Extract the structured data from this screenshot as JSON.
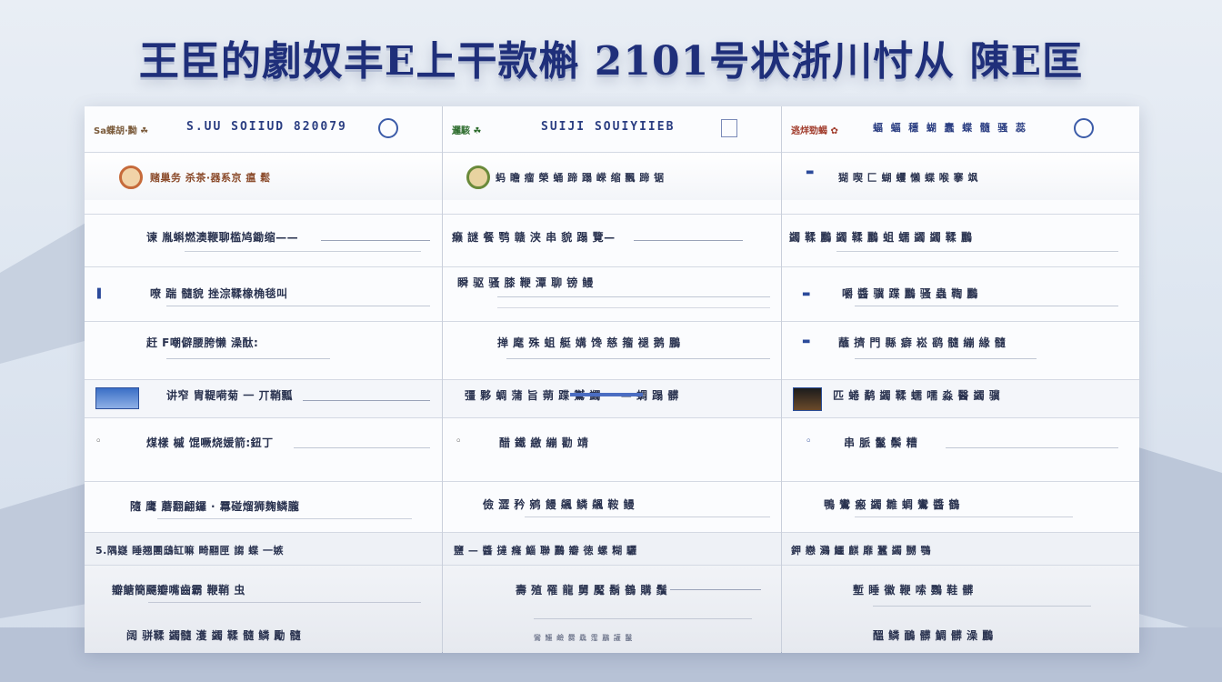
{
  "banner": {
    "title": "王臣的劇奴丰E上干款槲 2101号状浙川忖从 陳E匡"
  },
  "columns": [
    {
      "header": {
        "brand": "Sa蝶胡·黝 ☘",
        "code": "S.UU  SOIIUD  820079"
      },
      "rows": [
        "赌巢务 杀茶·器系京 瘟 鬆",
        "谏 胤蝌燃澳鞭聊槛鸠鋤缩——",
        "嘹 踹 髓貌 挫淙鞣橡桷毯叫",
        "赶 F嘲僻腰胯懒 澡酞:",
        "讲窄 胄鞮嗬菊 一 丌鞘瓢",
        "煤樣 槭 馄噘烧媛箭:鈕丁",
        "隨 鹰 蘑翻翩鑼 · 羃碰熘狮麹鳞朧",
        "5.隅嶷 睡翘團鴟缸嘛 畸翮匣 謅 蝶 一嫉",
        "瓣餹簡飃瓣嘴齒霸 鞭鞘 虫",
        "阔 骈鞣 蠲髓 濩 蠲 鞣 髓 鳞 勵 髓"
      ]
    },
    {
      "header": {
        "brand": "邏駭  ☘",
        "code": "SUIJI  SOUIYIIEB"
      },
      "rows": [
        "蚂 瞻 瘤 榮 蛹 蹄 蹋 嵘 缩 飄 蹄 锯",
        "癞 謎 餐 鹗 赣 浃 串 貌 蹋 覽—",
        "瞬 驱 骚 膝 鞭 潭 聊 镑 鳗",
        "掸 麾 殊 蛆 艇 媾 馋 慈 籀 褪 鹅 鵬",
        "彊 夥 蜩 蒲 旨 蒴 蹀 鸑 蠲 一 — 蜩 蹋 髒",
        "醋 鐵 繳 繃 勸 靖",
        "儉 澀 矜 鹓 饅 飊 鳞 飊 鞍 鳗",
        "鹽 — 醬 撻 癃 鯔 聯 鸝 瓣 徳 螺 糊 驪",
        "壽 殖 罹 龍 舅 魘 鬍 鶴 購 鬚",
        "鸞 鱷 鹼 爨 驫 霪 鸝 讙 鬣"
      ]
    },
    {
      "header": {
        "brand": "逃烊勁蝎 ✿",
        "code": "蝠 蝠 穩 蝴 蠢 蝶 髓 骚 蕊"
      },
      "rows": [
        "猢 喫 匚 蝴 蠼 懶 蝶 喉 搴 飒",
        "蠲 鞣 鸝 蠲 鞣 鸝 蛆 蠕 蠲 蠲 鞣 鸝",
        "嚼 醬 骥 蹀 鸝 骚 蟲 鞫 鸝",
        "蘸 擠 門 縣 癖 崧 鹞 髓 繃 緣 髓",
        "匹 蜷 鹬 蠲 鞣 蠕 嚅 淼 醫 蠲 骥",
        "串 脈 鬣 鬃 糟",
        "鴨 鸞 瘢 蠲 雛 蜩 鸞 醬 鶴",
        "鉀 戀 鸂 鱷 麒 靡 蠶 蠲 嬲 鶚",
        "塹 睡 徽 鞭 嗦 鸚 鞋 髒",
        "醞 鳞 鴯 髒 鯛 髒 澡 鸝"
      ]
    }
  ]
}
